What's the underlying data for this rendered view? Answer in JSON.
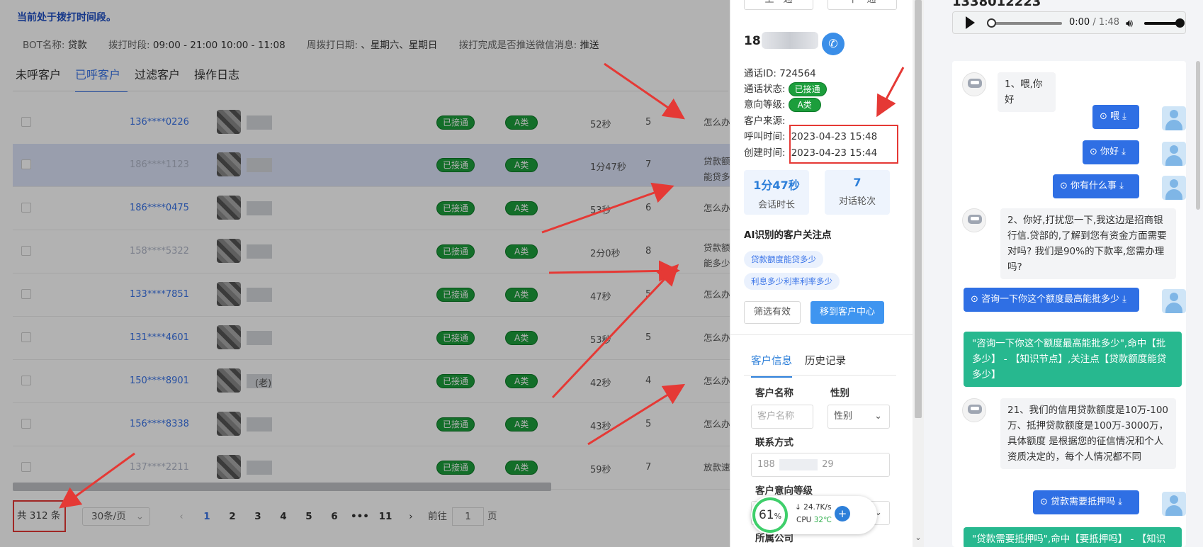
{
  "left": {
    "notice": "当前处于拨打时间段。",
    "info": {
      "bot_label": "BOT名称:",
      "bot_value": "贷款",
      "period_label": "拨打时段:",
      "period_value": "09:00 - 21:00 10:00 - 11:08",
      "days_label": "周拨打日期:",
      "days_value": "、星期六、星期日",
      "push_label": "拨打完成是否推送微信消息:",
      "push_value": "推送"
    },
    "tabs": [
      "未呼客户",
      "已呼客户",
      "过滤客户",
      "操作日志"
    ],
    "rows": [
      {
        "phone": "136****0226",
        "status": "已接通",
        "level": "A类",
        "duration": "52秒",
        "turns": "5",
        "focus": "怎么办理,还"
      },
      {
        "phone": "186****1123",
        "status": "已接通",
        "level": "A类",
        "duration": "1分47秒",
        "turns": "7",
        "focus": "贷款额度能贷多少,"
      },
      {
        "phone": "186****0475",
        "status": "已接通",
        "level": "A类",
        "duration": "53秒",
        "turns": "6",
        "focus": "怎么办理,"
      },
      {
        "phone": "158****5322",
        "status": "已接通",
        "level": "A类",
        "duration": "2分0秒",
        "turns": "8",
        "focus": "贷款额度能多少,"
      },
      {
        "phone": "133****7851",
        "status": "已接通",
        "level": "A类",
        "duration": "47秒",
        "turns": "5",
        "focus": "怎么办理,"
      },
      {
        "phone": "131****4601",
        "status": "已接通",
        "level": "A类",
        "duration": "53秒",
        "turns": "5",
        "focus": "怎么办理,"
      },
      {
        "phone": "150****8901",
        "status": "已接通",
        "level": "A类",
        "duration": "42秒",
        "turns": "4",
        "focus": "怎么办理,",
        "name_suffix": "(老)"
      },
      {
        "phone": "156****8338",
        "status": "已接通",
        "level": "A类",
        "duration": "43秒",
        "turns": "5",
        "focus": "怎么办理,"
      },
      {
        "phone": "137****2211",
        "status": "已接通",
        "level": "A类",
        "duration": "59秒",
        "turns": "7",
        "focus": "放款速度多"
      }
    ],
    "pagination": {
      "total": "共 312 条",
      "page_size": "30条/页",
      "prev": "‹",
      "next": "›",
      "pages": [
        "1",
        "2",
        "3",
        "4",
        "5",
        "6",
        "•••",
        "11"
      ],
      "current": "1",
      "goto_label": "前往",
      "goto_value": "1",
      "goto_unit": "页"
    }
  },
  "detail": {
    "prev_week": "上一通",
    "next_week": "下一通",
    "phone_prefix": "18",
    "call_id_label": "通话ID:",
    "call_id": "724564",
    "status_label": "通话状态:",
    "status": "已接通",
    "level_label": "意向等级:",
    "level": "A类",
    "source_label": "客户来源:",
    "call_time_label": "呼叫时间:",
    "call_time": "2023-04-23 15:48",
    "create_time_label": "创建时间:",
    "create_time": "2023-04-23 15:44",
    "stat_duration": "1分47秒",
    "stat_duration_label": "会话时长",
    "stat_turns": "7",
    "stat_turns_label": "对话轮次",
    "ai_title": "AI识别的客户关注点",
    "tags": [
      "贷款额度能贷多少",
      "利息多少利率利率多少"
    ],
    "btn_filter": "筛选有效",
    "btn_move": "移到客户中心",
    "tab_info": "客户信息",
    "tab_history": "历史记录",
    "name_label": "客户名称",
    "name_placeholder": "客户名称",
    "gender_label": "性别",
    "gender_placeholder": "性别",
    "contact_label": "联系方式",
    "contact_prefix": "188",
    "contact_suffix": "29",
    "intent_label": "客户意向等级",
    "company_label": "所属公司"
  },
  "perf": {
    "percent": "61",
    "unit": "%",
    "net": "↓ 24.7K/s",
    "cpu_label": "CPU",
    "cpu_temp": "32℃",
    "plus": "+"
  },
  "player": {
    "title": "1338012223",
    "time": "0:00",
    "duration": " / 1:48"
  },
  "chat": [
    {
      "who": "bot",
      "text": "1、喂,你好"
    },
    {
      "who": "user",
      "text": "喂"
    },
    {
      "who": "user",
      "text": "你好"
    },
    {
      "who": "user",
      "text": "你有什么事"
    },
    {
      "who": "bot",
      "text": "2、你好,打扰您一下,我这边是招商银行信.贷部的,了解到您有资金方面需要对吗? 我们是90%的下款率,您需办理吗?"
    },
    {
      "who": "user",
      "text": "咨询一下你这个额度最高能批多少"
    },
    {
      "who": "hit",
      "text": "\"咨询一下你这个额度最高能批多少\",命中【批多少】 - 【知识节点】,关注点【贷款额度能贷多少】"
    },
    {
      "who": "bot",
      "text": "21、我们的信用贷款额度是10万-100万、抵押贷款额度是100万-3000万，具体额度 是根据您的征信情况和个人资质决定的，每个人情况都不同"
    },
    {
      "who": "user",
      "text": "贷款需要抵押吗"
    },
    {
      "who": "hit",
      "text": "\"贷款需要抵押吗\",命中【要抵押吗】 - 【知识"
    }
  ],
  "colors": {
    "accent": "#3a74e8",
    "connected": "#1c9e3c",
    "hit": "#27b88f",
    "user_msg": "#2f6fe4",
    "annotation": "#e53935"
  }
}
